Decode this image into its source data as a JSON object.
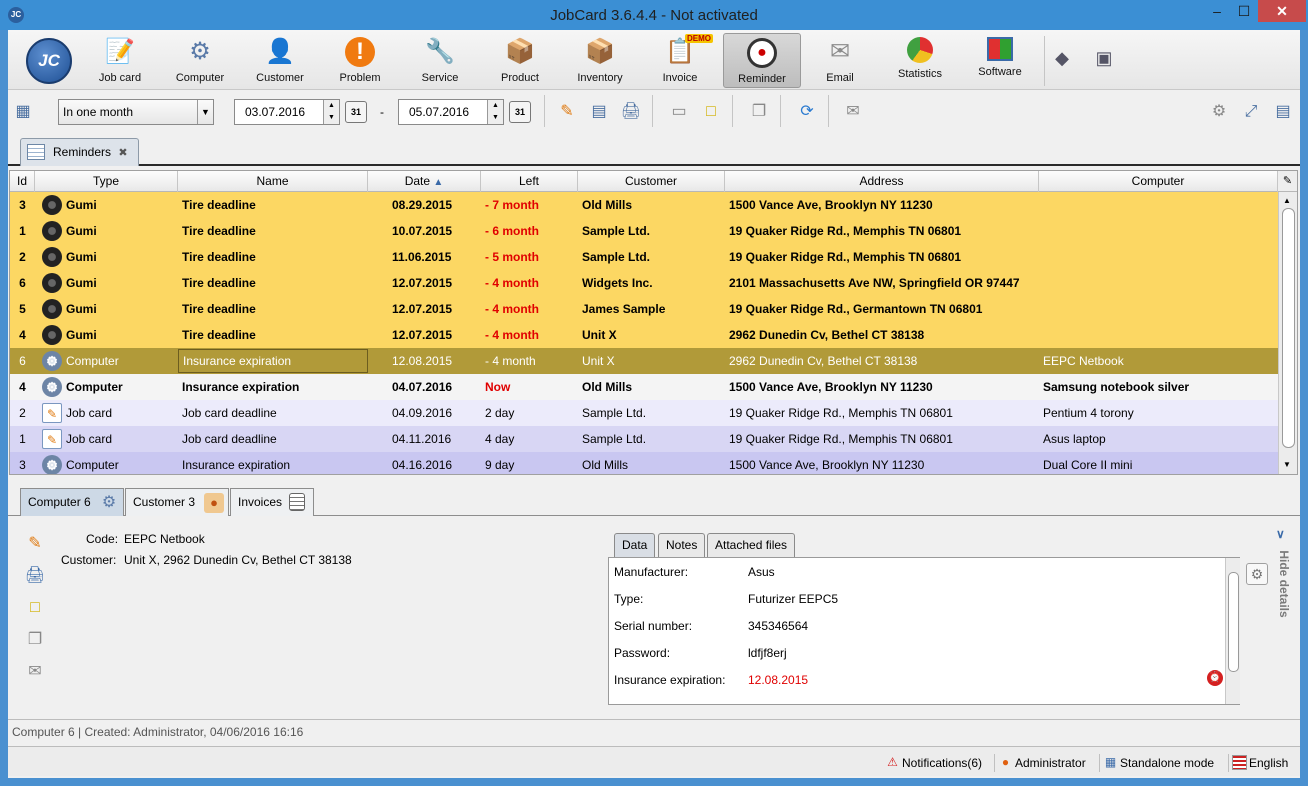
{
  "window": {
    "title": "JobCard 3.6.4.4 - Not activated",
    "app_icon": "JC"
  },
  "toolbar": {
    "logo": "JC",
    "buttons": [
      {
        "label": "Job card"
      },
      {
        "label": "Computer"
      },
      {
        "label": "Customer"
      },
      {
        "label": "Problem"
      },
      {
        "label": "Service"
      },
      {
        "label": "Product"
      },
      {
        "label": "Inventory"
      },
      {
        "label": "Invoice",
        "badge": "DEMO"
      },
      {
        "label": "Reminder"
      },
      {
        "label": "Email"
      },
      {
        "label": "Statistics"
      },
      {
        "label": "Software"
      }
    ]
  },
  "filter": {
    "period": "In one month",
    "date_from": "03.07.2016",
    "date_to": "05.07.2016",
    "calendar_label": "31",
    "separator": "-"
  },
  "tab": {
    "label": "Reminders"
  },
  "table": {
    "columns": [
      "Id",
      "Type",
      "Name",
      "Date",
      "Left",
      "Customer",
      "Address",
      "Computer"
    ],
    "rows": [
      {
        "id": "3",
        "type": "Gumi",
        "name": "Tire deadline",
        "date": "08.29.2015",
        "left": "- 7 month",
        "customer": "Old Mills",
        "address": "1500 Vance Ave, Brooklyn NY 11230",
        "computer": ""
      },
      {
        "id": "1",
        "type": "Gumi",
        "name": "Tire deadline",
        "date": "10.07.2015",
        "left": "- 6 month",
        "customer": "Sample Ltd.",
        "address": "19 Quaker Ridge Rd., Memphis TN 06801",
        "computer": ""
      },
      {
        "id": "2",
        "type": "Gumi",
        "name": "Tire deadline",
        "date": "11.06.2015",
        "left": "- 5 month",
        "customer": "Sample Ltd.",
        "address": "19 Quaker Ridge Rd., Memphis TN 06801",
        "computer": ""
      },
      {
        "id": "6",
        "type": "Gumi",
        "name": "Tire deadline",
        "date": "12.07.2015",
        "left": "- 4 month",
        "customer": "Widgets Inc.",
        "address": "2101 Massachusetts Ave NW, Springfield OR 97447",
        "computer": ""
      },
      {
        "id": "5",
        "type": "Gumi",
        "name": "Tire deadline",
        "date": "12.07.2015",
        "left": "- 4 month",
        "customer": "James Sample",
        "address": "19 Quaker Ridge Rd., Germantown TN 06801",
        "computer": ""
      },
      {
        "id": "4",
        "type": "Gumi",
        "name": "Tire deadline",
        "date": "12.07.2015",
        "left": "- 4 month",
        "customer": "Unit X",
        "address": "2962 Dunedin Cv, Bethel CT 38138",
        "computer": ""
      },
      {
        "id": "6",
        "type": "Computer",
        "name": "Insurance expiration",
        "date": "12.08.2015",
        "left": "- 4 month",
        "customer": "Unit X",
        "address": "2962 Dunedin Cv, Bethel CT 38138",
        "computer": "EEPC Netbook"
      },
      {
        "id": "4",
        "type": "Computer",
        "name": "Insurance expiration",
        "date": "04.07.2016",
        "left": "Now",
        "customer": "Old Mills",
        "address": "1500 Vance Ave, Brooklyn NY 11230",
        "computer": "Samsung notebook silver"
      },
      {
        "id": "2",
        "type": "Job card",
        "name": "Job card deadline",
        "date": "04.09.2016",
        "left": "2 day",
        "customer": "Sample Ltd.",
        "address": "19 Quaker Ridge Rd., Memphis TN 06801",
        "computer": "Pentium 4 torony"
      },
      {
        "id": "1",
        "type": "Job card",
        "name": "Job card deadline",
        "date": "04.11.2016",
        "left": "4 day",
        "customer": "Sample Ltd.",
        "address": "19 Quaker Ridge Rd., Memphis TN 06801",
        "computer": "Asus laptop"
      },
      {
        "id": "3",
        "type": "Computer",
        "name": "Insurance expiration",
        "date": "04.16.2016",
        "left": "9 day",
        "customer": "Old Mills",
        "address": "1500 Vance Ave, Brooklyn NY 11230",
        "computer": "Dual Core II mini"
      }
    ]
  },
  "detail_tabs": [
    "Computer 6",
    "Customer 3",
    "Invoices"
  ],
  "details": {
    "code_label": "Code:",
    "code_value": "EEPC Netbook",
    "customer_label": "Customer:",
    "customer_value": "Unit X, 2962 Dunedin Cv, Bethel CT 38138",
    "subtabs": [
      "Data",
      "Notes",
      "Attached files"
    ],
    "fields": [
      {
        "k": "Manufacturer:",
        "v": "Asus"
      },
      {
        "k": "Type:",
        "v": "Futurizer EEPC5"
      },
      {
        "k": "Serial number:",
        "v": "345346564"
      },
      {
        "k": "Password:",
        "v": "ldfjf8erj"
      },
      {
        "k": "Insurance expiration:",
        "v": "12.08.2015"
      }
    ],
    "hide_label": "Hide details"
  },
  "info": "Computer 6 | Created: Administrator, 04/06/2016 16:16",
  "status": {
    "notifications": "Notifications(6)",
    "user": "Administrator",
    "mode": "Standalone mode",
    "language": "English"
  },
  "colors": {
    "overdue_row": "#fcd763",
    "selected_row": "#b19a39",
    "today_row": "#f4f4f4",
    "lavender_row": "#ecebfb",
    "lavender_row_alt": "#d8d6f4",
    "lavender_row_last": "#c9c7f1",
    "red_text": "#e00000",
    "window_blue": "#3b8fd4"
  }
}
